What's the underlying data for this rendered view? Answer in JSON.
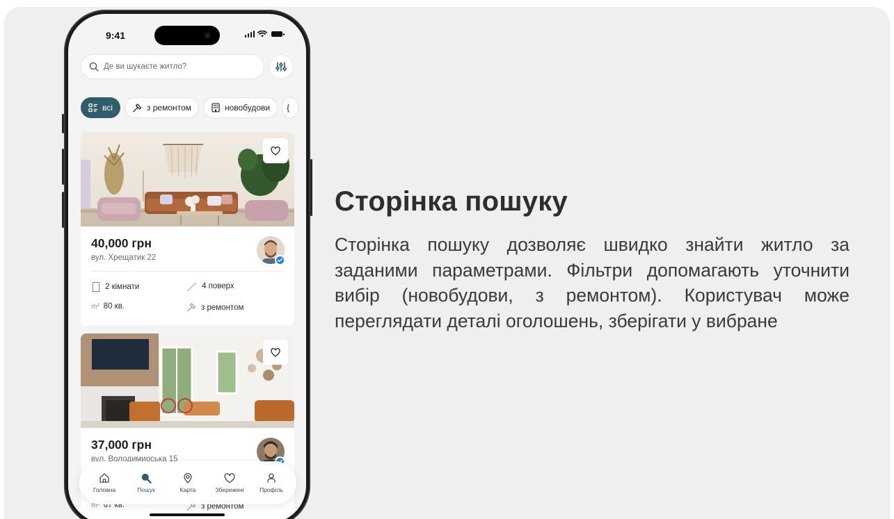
{
  "status_bar": {
    "time": "9:41"
  },
  "search": {
    "placeholder": "Де ви шукаєте житло?"
  },
  "chips": [
    {
      "label": "всі",
      "icon": "list-icon",
      "active": true
    },
    {
      "label": "з ремонтом",
      "icon": "hammer-icon",
      "active": false
    },
    {
      "label": "новобудови",
      "icon": "building-icon",
      "active": false
    }
  ],
  "listings": [
    {
      "price": "40,000 грн",
      "address": "вул. Хрещатик 22",
      "rooms": "2 кімнати",
      "floor": "4 поверх",
      "area": "80 кв.",
      "renovation": "з ремонтом"
    },
    {
      "price": "37,000 грн",
      "address": "вул. Володимирська 15",
      "area": "67 кв.",
      "renovation": "з ремонтом"
    }
  ],
  "tabbar": [
    {
      "label": "Головна",
      "icon": "home-icon",
      "active": false
    },
    {
      "label": "Пошук",
      "icon": "search-icon",
      "active": true
    },
    {
      "label": "Карта",
      "icon": "map-pin-icon",
      "active": false
    },
    {
      "label": "Збережені",
      "icon": "heart-icon",
      "active": false
    },
    {
      "label": "Профіль",
      "icon": "profile-icon",
      "active": false
    }
  ],
  "colors": {
    "accent": "#2f5d69",
    "verified": "#2d7fd6",
    "background": "#efefef"
  },
  "text": {
    "heading": "Сторінка пошуку",
    "description": "Сторінка пошуку дозволяє швидко знайти житло за заданими параметрами. Фільтри допомагають уточнити вибір (новобудови, з ремонтом). Користувач може переглядати деталі оголошень, зберігати у вибране"
  }
}
